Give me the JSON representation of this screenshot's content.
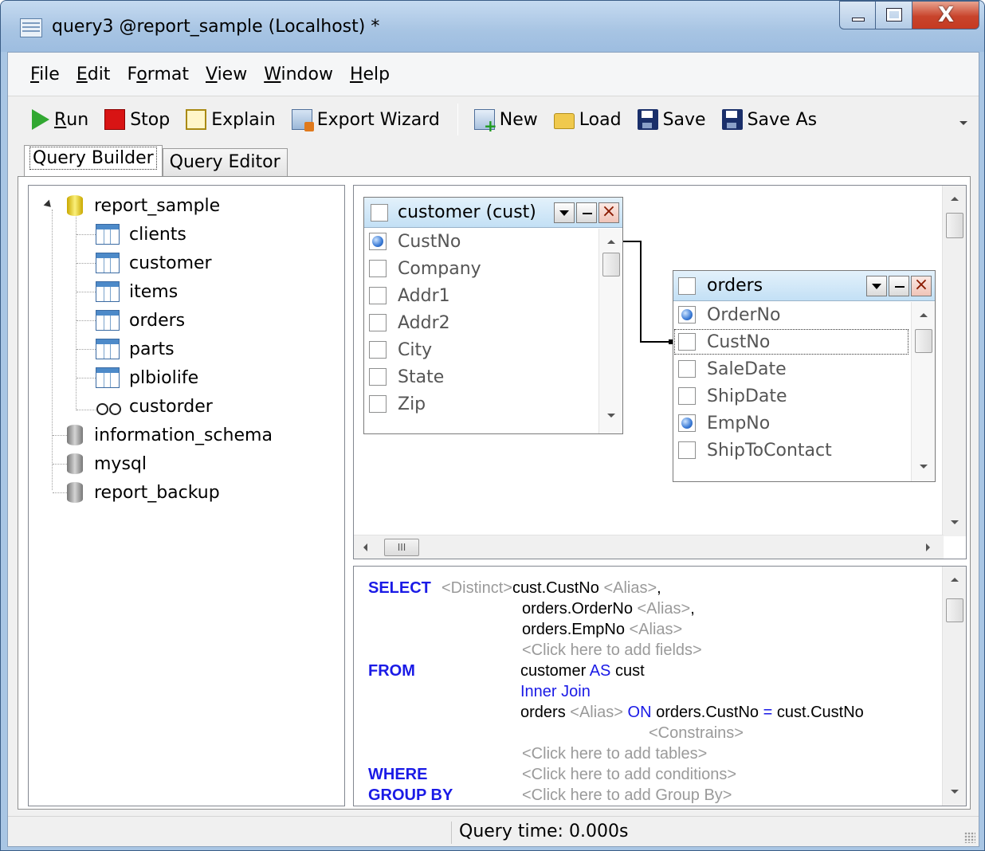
{
  "window": {
    "title": "query3 @report_sample (Localhost) *"
  },
  "menu": [
    {
      "label": "File",
      "accel": "F",
      "rest": "ile"
    },
    {
      "label": "Edit",
      "accel": "E",
      "rest": "dit"
    },
    {
      "label": "Format",
      "pre": "F",
      "accel": "o",
      "rest": "rmat"
    },
    {
      "label": "View",
      "accel": "V",
      "rest": "iew"
    },
    {
      "label": "Window",
      "accel": "W",
      "rest": "indow"
    },
    {
      "label": "Help",
      "accel": "H",
      "rest": "elp"
    }
  ],
  "toolbar": {
    "run_accel": "R",
    "run_rest": "un",
    "stop": "Stop",
    "explain": "Explain",
    "export": "Export Wizard",
    "new": "New",
    "load": "Load",
    "save": "Save",
    "save_as": "Save As"
  },
  "tabs": {
    "builder": "Query Builder",
    "editor": "Query Editor",
    "active": "builder"
  },
  "tree": {
    "root": "report_sample",
    "tables": [
      "clients",
      "customer",
      "items",
      "orders",
      "parts",
      "plbiolife"
    ],
    "views": [
      "custorder"
    ],
    "databases": [
      "information_schema",
      "mysql",
      "report_backup"
    ]
  },
  "diagram": {
    "customer": {
      "name": "customer (cust)",
      "fields": [
        {
          "name": "CustNo",
          "checked": true
        },
        {
          "name": "Company",
          "checked": false
        },
        {
          "name": "Addr1",
          "checked": false
        },
        {
          "name": "Addr2",
          "checked": false
        },
        {
          "name": "City",
          "checked": false
        },
        {
          "name": "State",
          "checked": false
        },
        {
          "name": "Zip",
          "checked": false
        }
      ]
    },
    "orders": {
      "name": "orders",
      "fields": [
        {
          "name": "OrderNo",
          "checked": true
        },
        {
          "name": "CustNo",
          "checked": false
        },
        {
          "name": "SaleDate",
          "checked": false
        },
        {
          "name": "ShipDate",
          "checked": false
        },
        {
          "name": "EmpNo",
          "checked": true
        },
        {
          "name": "ShipToContact",
          "checked": false
        }
      ]
    },
    "hscroll_label": "III"
  },
  "sql": {
    "select": "SELECT",
    "distinct": "<Distinct>",
    "field1": "cust.CustNo",
    "field2": "orders.OrderNo",
    "field3": "orders.EmpNo",
    "alias": "<Alias>",
    "comma": ",",
    "add_fields": "<Click here to add fields>",
    "from": "FROM",
    "from_table": "customer",
    "as": "AS",
    "from_alias": "cust",
    "join": "Inner Join",
    "join_table": "orders",
    "on": "ON",
    "on_left": "orders.CustNo",
    "eq": "=",
    "on_right": "cust.CustNo",
    "constrains": "<Constrains>",
    "add_tables": "<Click here to add tables>",
    "where": "WHERE",
    "add_conditions": "<Click here to add conditions>",
    "group_by": "GROUP BY",
    "add_group_by": "<Click here to add Group By>"
  },
  "status": {
    "query_time": "Query time: 0.000s"
  },
  "colors": {
    "keyword": "#1a1ae6",
    "placeholder": "#9a9a9a",
    "title_bar": "#a9c6e4"
  }
}
